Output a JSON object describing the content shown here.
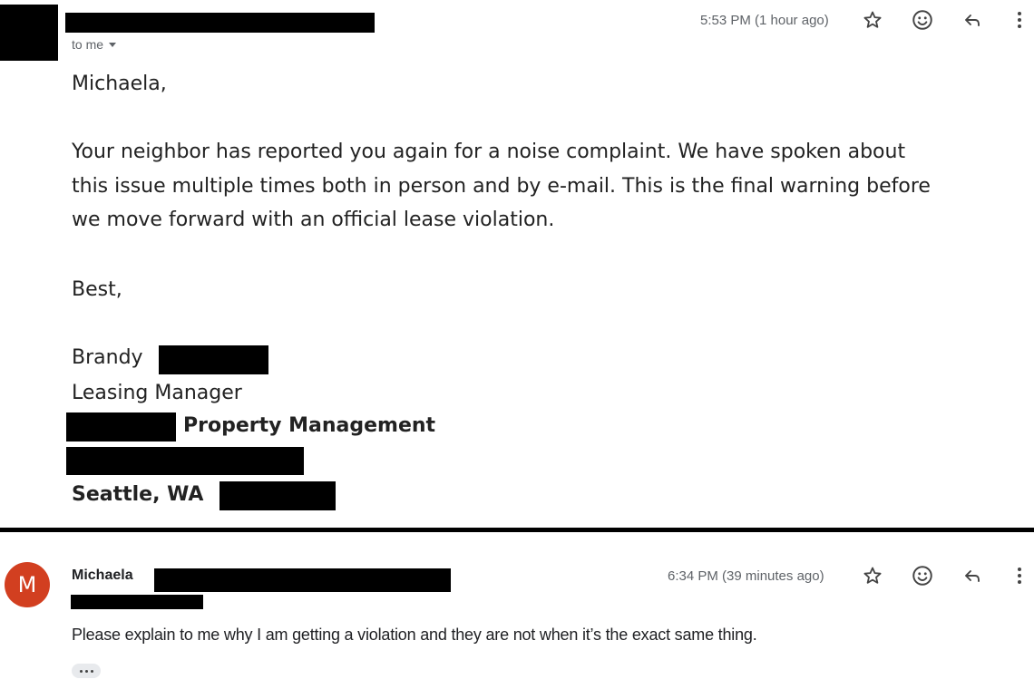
{
  "message1": {
    "to_label": "to me",
    "timestamp": "5:53 PM (1 hour ago)",
    "greeting": "Michaela,",
    "paragraph_lines": [
      "Your neighbor has reported you again for a noise complaint. We have spoken about",
      "this issue multiple times both in person and by e-mail. This is the final warning before",
      "we move forward with an official lease violation."
    ],
    "closing": "Best,",
    "signature": {
      "first_name": "Brandy",
      "title": "Leasing Manager",
      "company_suffix": "Property Management",
      "city_state": "Seattle, WA"
    }
  },
  "message2": {
    "avatar_letter": "M",
    "sender_name": "Michaela",
    "timestamp": "6:34 PM (39 minutes ago)",
    "body": "Please explain to me why I am getting a violation and they are not when it’s the exact same thing."
  },
  "icons": [
    "star-icon",
    "emoji-icon",
    "reply-icon",
    "more-vert-icon",
    "chevron-down-icon",
    "ellipsis-icon"
  ],
  "colors": {
    "avatar": "#d23f20",
    "meta_text": "#5f6368",
    "redaction": "#000000"
  }
}
